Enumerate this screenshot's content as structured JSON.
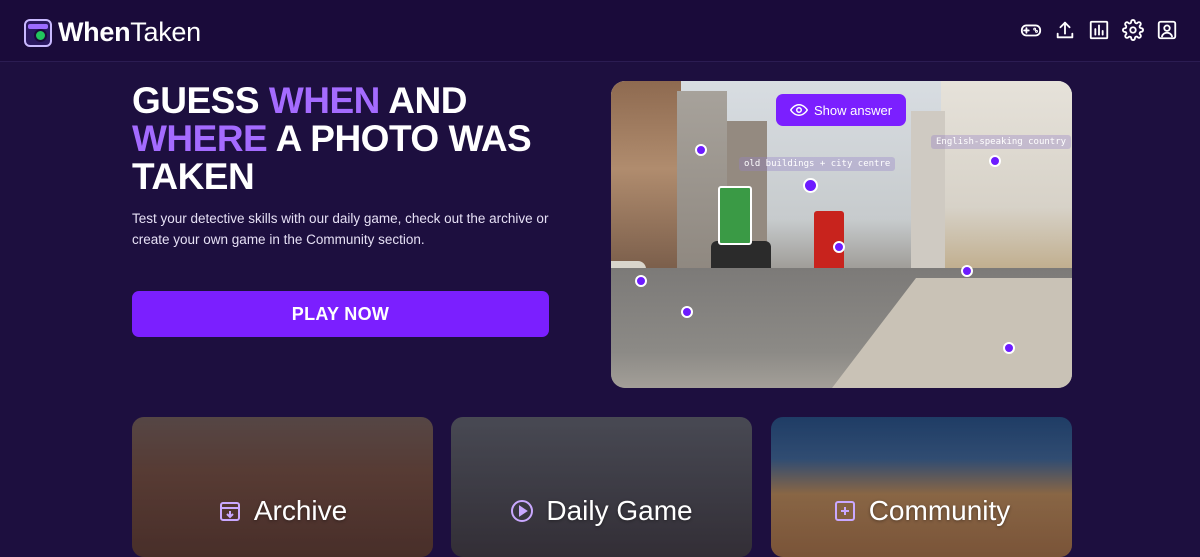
{
  "app": {
    "name_bold": "When",
    "name_light": "Taken"
  },
  "header": {
    "icons": [
      "gamepad-icon",
      "upload-icon",
      "stats-icon",
      "gear-icon",
      "profile-icon"
    ]
  },
  "hero": {
    "title_1": "GUESS ",
    "title_accent_1": "WHEN",
    "title_2": " AND ",
    "title_accent_2": "WHERE",
    "title_3": " A PHOTO WAS TAKEN",
    "description": "Test your detective skills with our daily game, check out the archive or create your own game in the Community section.",
    "play_label": "PLAY NOW"
  },
  "photo": {
    "show_answer_label": "Show answer",
    "hints": [
      "old buildings + city centre",
      "English-speaking country"
    ]
  },
  "cards": [
    {
      "label": "Archive",
      "icon": "calendar-download-icon"
    },
    {
      "label": "Daily Game",
      "icon": "play-circle-icon"
    },
    {
      "label": "Community",
      "icon": "plus-square-icon"
    }
  ],
  "colors": {
    "background": "#1d0f3f",
    "accent": "#a46bff",
    "primary": "#7b1fff"
  }
}
